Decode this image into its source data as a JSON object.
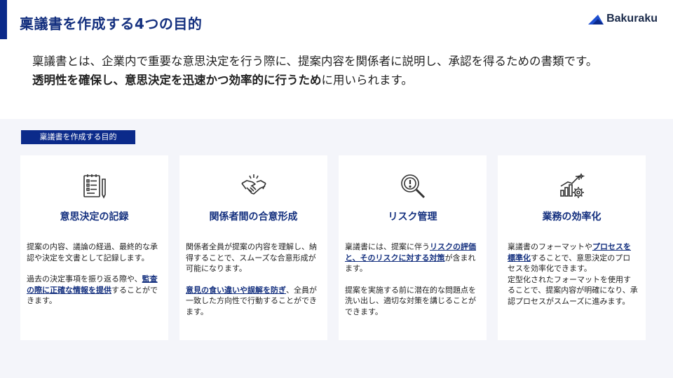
{
  "header": {
    "title": "稟議書を作成する4つの目的",
    "logo_text": "Bakuraku"
  },
  "intro": {
    "line1": "稟議書とは、企業内で重要な意思決定を行う際に、提案内容を関係者に説明し、承認を得るための書類です。",
    "line2_strong": "透明性を確保し、意思決定を迅速かつ効率的に行うため",
    "line2_rest": "に用いられます。"
  },
  "section": {
    "tag": "稟議書を作成する目的"
  },
  "cards": [
    {
      "icon": "checklist-clipboard-icon",
      "title": "意思決定の記録",
      "p1": "提案の内容、議論の経過、最終的な承認や決定を文書として記録します。",
      "p2_pre": "過去の決定事項を振り返る際や、",
      "p2_hl": "監査の際に正確な情報を提供",
      "p2_post": "することができます。"
    },
    {
      "icon": "handshake-icon",
      "title": "関係者間の合意形成",
      "p1": "関係者全員が提案の内容を理解し、納得することで、スムーズな合意形成が可能になります。",
      "p2_pre": "",
      "p2_hl": "意見の食い違いや誤解を防ぎ",
      "p2_post": "、全員が一致した方向性で行動することができます。"
    },
    {
      "icon": "magnifier-warning-icon",
      "title": "リスク管理",
      "p1_pre": "稟議書には、提案に伴う",
      "p1_hl": "リスクの評価と、そのリスクに対する対策",
      "p1_post": "が含まれます。",
      "p2": "提案を実施する前に潜在的な問題点を洗い出し、適切な対策を講じることができます。"
    },
    {
      "icon": "growth-chart-gear-icon",
      "title": "業務の効率化",
      "p1_pre": "稟議書のフォーマットや",
      "p1_hl": "プロセスを標準化",
      "p1_post": "することで、意思決定のプロセスを効率化できます。",
      "p1_extra": "定型化されたフォーマットを使用することで、提案内容が明確になり、承認プロセスがスムーズに進みます。"
    }
  ],
  "colors": {
    "accent": "#0b2a8a",
    "title": "#14307f",
    "panel": "#f4f5fa"
  }
}
